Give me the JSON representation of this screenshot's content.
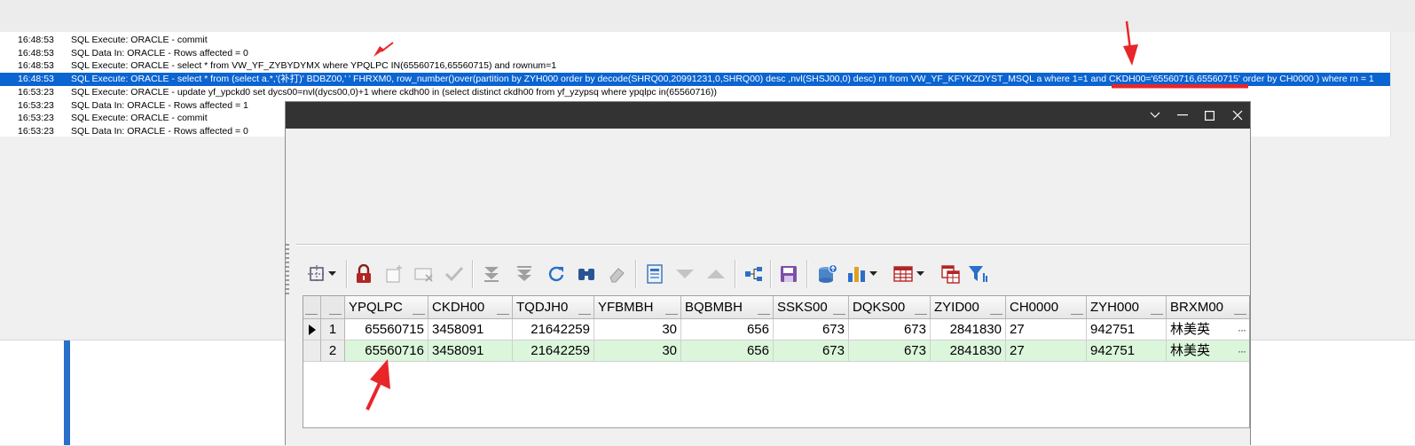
{
  "log": {
    "rows": [
      {
        "time": "16:48:53",
        "message": "SQL Execute: ORACLE -  commit"
      },
      {
        "time": "16:48:53",
        "message": "SQL Data In: ORACLE - Rows affected = 0"
      },
      {
        "time": "16:48:53",
        "message": "SQL Execute: ORACLE - select * from VW_YF_ZYBYDYMX where YPQLPC IN(65560716,65560715) and rownum=1"
      },
      {
        "time": "16:48:53",
        "message": "SQL Execute: ORACLE -  select * from (select a.*,'(补打)' BDBZ00,' ' FHRXM0, row_number()over(partition by ZYH000 order by decode(SHRQ00,20991231,0,SHRQ00) desc ,nvl(SHSJ00,0) desc) rn from VW_YF_KFYKZDYST_MSQL a where 1=1   and CKDH00='65560716,65560715' order by CH0000  ) where rn = 1"
      },
      {
        "time": "16:53:23",
        "message": "SQL Execute: ORACLE - update yf_ypckd0 set dycs00=nvl(dycs00,0)+1 where ckdh00 in (select distinct ckdh00 from yf_yzypsq where ypqlpc in(65560716))"
      },
      {
        "time": "16:53:23",
        "message": "SQL Data In: ORACLE - Rows affected = 1"
      },
      {
        "time": "16:53:23",
        "message": "SQL Execute: ORACLE -  commit"
      },
      {
        "time": "16:53:23",
        "message": "SQL Data In: ORACLE - Rows affected = 0"
      }
    ],
    "selected_index": 3
  },
  "dialog": {
    "window_controls": [
      "chevron-down",
      "minimize",
      "maximize",
      "close"
    ]
  },
  "toolbar": {
    "icons": [
      "grid-settings-icon",
      "dropdown-arrow-icon",
      "lock-icon",
      "new-record-icon",
      "cancel-edit-icon",
      "post-check-icon",
      "first-record-icon",
      "last-record-icon",
      "refresh-icon",
      "find-icon",
      "eraser-icon",
      "report-icon",
      "sort-desc-icon",
      "sort-asc-icon",
      "tree-icon",
      "save-icon",
      "export-icon",
      "chart-icon",
      "dropdown-arrow-icon",
      "table-icon",
      "dropdown-arrow-icon",
      "copy-table-icon",
      "filter-icon"
    ]
  },
  "grid": {
    "columns": [
      "YPQLPC",
      "CKDH00",
      "TQDJH0",
      "YFBMBH",
      "BQBMBH",
      "SSKS00",
      "DQKS00",
      "ZYID00",
      "CH0000",
      "ZYH000",
      "BRXM00"
    ],
    "rows": [
      {
        "rownum": "1",
        "cells": [
          "65560715",
          "3458091",
          "21642259",
          "30",
          "656",
          "673",
          "673",
          "2841830",
          "27",
          "942751",
          "林美英"
        ]
      },
      {
        "rownum": "2",
        "cells": [
          "65560716",
          "3458091",
          "21642259",
          "30",
          "656",
          "673",
          "673",
          "2841830",
          "27",
          "942751",
          "林美英"
        ]
      }
    ],
    "current_row": 0,
    "selected_row": 1,
    "ellipsis": "···"
  },
  "colors": {
    "log_selection": "#0a64d2",
    "titlebar": "#333333",
    "row_selected": "#dcf6dc",
    "annotation": "#e8262a"
  }
}
